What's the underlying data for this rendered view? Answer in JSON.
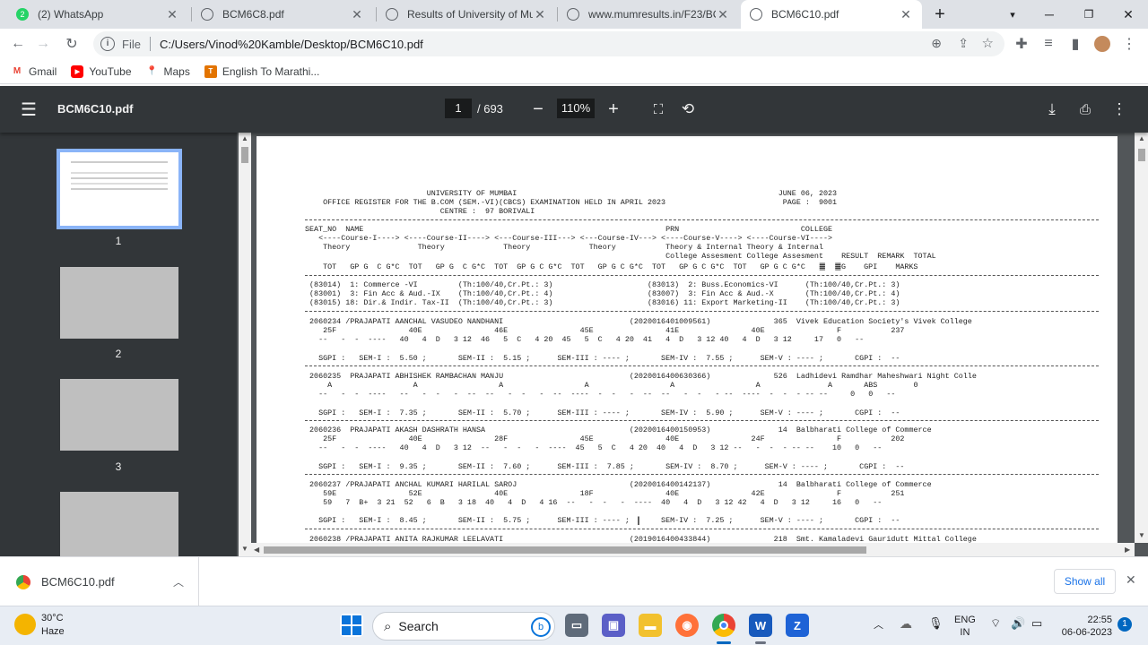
{
  "tabs": [
    {
      "title": "(2) WhatsApp",
      "icon": "whatsapp-icon"
    },
    {
      "title": "BCM6C8.pdf",
      "icon": "globe-icon"
    },
    {
      "title": "Results of University of Mum",
      "icon": "globe-icon"
    },
    {
      "title": "www.mumresults.in/F23/BCM",
      "icon": "globe-icon"
    },
    {
      "title": "BCM6C10.pdf",
      "icon": "globe-icon",
      "active": true
    }
  ],
  "address": {
    "scheme": "File",
    "url": "C:/Users/Vinod%20Kamble/Desktop/BCM6C10.pdf"
  },
  "bookmarks": [
    {
      "label": "Gmail",
      "icon": "gmail-icon"
    },
    {
      "label": "YouTube",
      "icon": "youtube-icon"
    },
    {
      "label": "Maps",
      "icon": "maps-icon"
    },
    {
      "label": "English To Marathi...",
      "icon": "bookmark-page-icon"
    }
  ],
  "pdf_toolbar": {
    "title": "BCM6C10.pdf",
    "page": "1",
    "total": "/ 693",
    "zoom": "110%"
  },
  "thumbnails": [
    "1",
    "2",
    "3"
  ],
  "pdf_lines": [
    "                           UNIVERSITY OF MUMBAI                                                          JUNE 06, 2023",
    "    OFFICE REGISTER FOR THE B.COM (SEM.-VI)(CBCS) EXAMINATION HELD IN APRIL 2023                          PAGE :  9001",
    "                              CENTRE :  97 BORIVALI",
    "SEAT_NO  NAME                                                                   PRN                           COLLEGE",
    "   <----Course-I----> <----Course-II----> <---Course-III---> <---Course-IV---> <----Course-V----> <----Course-VI---->",
    "    Theory               Theory             Theory             Theory           Theory & Internal Theory & Internal",
    "                                                                                College Assesment College Assesment    RESULT  REMARK  TOTAL",
    "    TOT   GP G  C G*C  TOT   GP G  C G*C  TOT  GP G C G*C  TOT   GP G C G*C  TOT   GP G C G*C  TOT   GP G C G*C   ䷀  ䷀G    GPI    MARKS",
    " (83014)  1: Commerce -VI         (Th:100/40,Cr.Pt.: 3)                     (83013)  2: Buss.Economics-VI      (Th:100/40,Cr.Pt.: 3)",
    " (83001)  3: Fin Acc & Aud.-IX    (Th:100/40,Cr.Pt.: 4)                     (83007)  3: Fin Acc & Aud.-X       (Th:100/40,Cr.Pt.: 4)",
    " (83015) 18: Dir.& Indir. Tax-II  (Th:100/40,Cr.Pt.: 3)                     (83016) 11: Export Marketing-II    (Th:100/40,Cr.Pt.: 3)",
    " 2060234 /PRAJAPATI AANCHAL VASUDEO NANDHANI                            (2020016401009561)              365  Vivek Education Society's Vivek College",
    "    25F                40E                46E                45E                41E                40E                F           237",
    "   --   -  -  ----   40   4  D   3 12  46   5  C   4 20  45   5  C   4 20  41   4  D   3 12 40   4  D   3 12     17   0   --",
    "   SGPI :   SEM-I :  5.50 ;       SEM-II :  5.15 ;      SEM-III : ---- ;       SEM-IV :  7.55 ;      SEM-V : ---- ;       CGPI :  --",
    " 2060235  PRAJAPATI ABHISHEK RAMBACHAN MANJU                            (2020016400630366)              526  Ladhidevi Ramdhar Maheshwari Night Colle",
    "     A                  A                  A                  A                  A                  A               A       ABS        0",
    "   --   -  -  ----   --   -  -   -  --  --   -  -   -  --  ----  -  -   -  --  --   -  -   - --  ----  -  -  - -- --     0   0   --",
    "   SGPI :   SEM-I :  7.35 ;       SEM-II :  5.70 ;      SEM-III : ---- ;       SEM-IV :  5.90 ;      SEM-V : ---- ;       CGPI :  --",
    " 2060236  PRAJAPATI AKASH DASHRATH HANSA                                (2020016400150953)               14  Balbharati College of Commerce",
    "    25F                40E                28F                45E                40E                24F                F           202",
    "   --   -  -  ----   40   4  D   3 12  --   -  -   -  ----  45   5  C   4 20  40   4  D   3 12 --   -  -  - -- --    10   0   --",
    "   SGPI :   SEM-I :  9.35 ;       SEM-II :  7.60 ;      SEM-III :  7.85 ;       SEM-IV :  8.70 ;      SEM-V : ---- ;       CGPI :  --",
    " 2060237 /PRAJAPATI ANCHAL KUMARI HARILAL SAROJ                         (2020016400142137)               14  Balbharati College of Commerce",
    "    59E                52E                40E                18F                40E                42E                F           251",
    "    59   7  B+  3 21  52   6  B   3 18  40   4  D   4 16  --   -  -   -  ----  40   4  D   3 12 42   4  D   3 12     16   0   --",
    "   SGPI :   SEM-I :  8.45 ;       SEM-II :  5.75 ;      SEM-III : ---- ;       SEM-IV :  7.25 ;      SEM-V : ---- ;       CGPI :  --",
    " 2060238 /PRAJAPATI ANITA RAJKUMAR LEELAVATI                            (2019016400433844)              218  Smt. Kamaladevi Gauridutt Mittal College"
  ],
  "download": {
    "filename": "BCM6C10.pdf",
    "show_all": "Show all"
  },
  "taskbar": {
    "weather_temp": "30°C",
    "weather_desc": "Haze",
    "search_label": "Search",
    "lang_top": "ENG",
    "lang_bottom": "IN",
    "time": "22:55",
    "date": "06-06-2023",
    "notification_count": "1"
  }
}
